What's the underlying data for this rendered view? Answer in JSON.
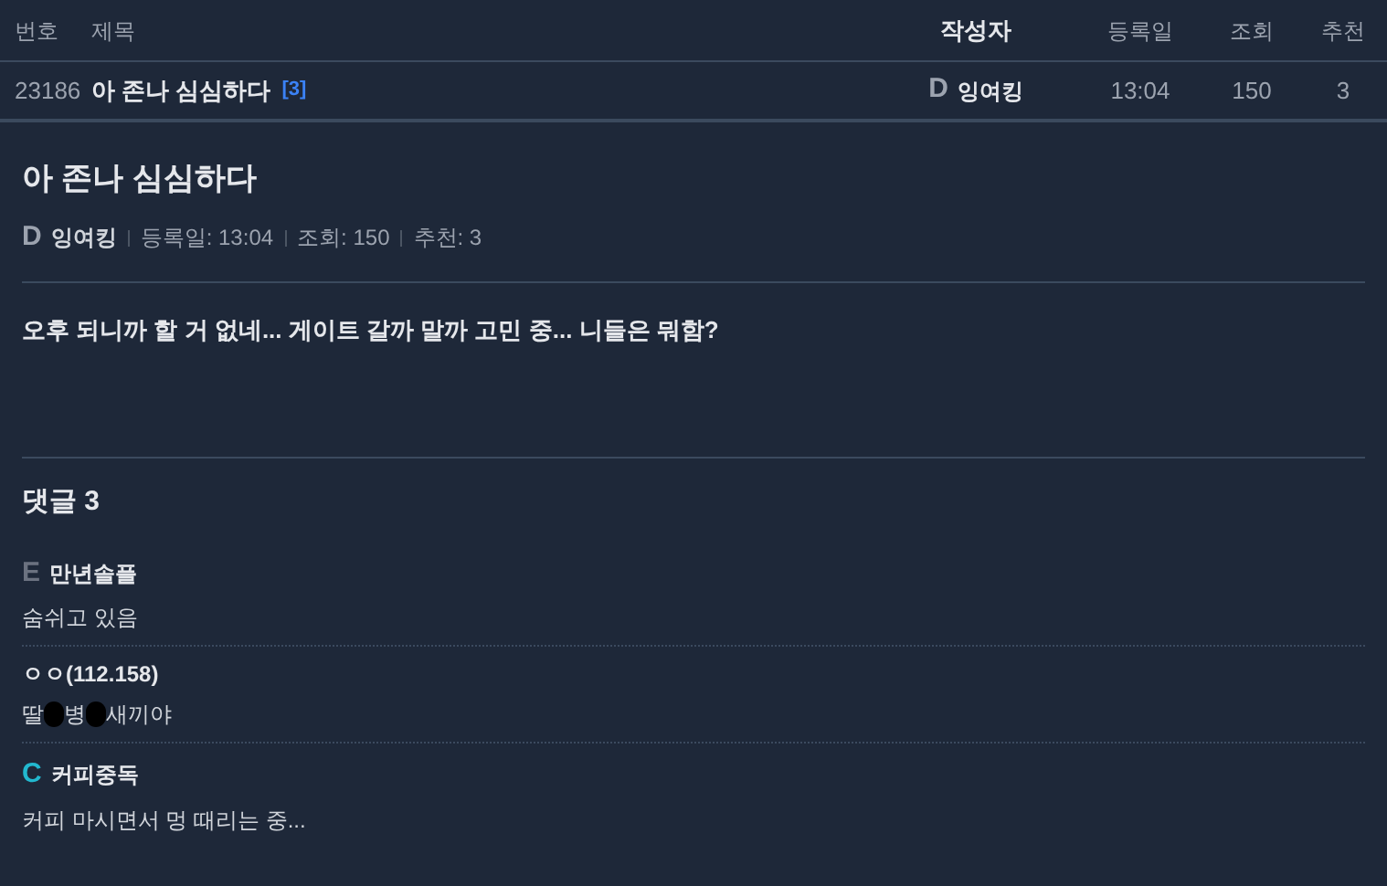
{
  "table": {
    "columns": [
      {
        "label": "번호",
        "bold": false
      },
      {
        "label": "제목",
        "bold": false
      },
      {
        "label": "작성자",
        "bold": true
      },
      {
        "label": "등록일",
        "bold": false
      },
      {
        "label": "조회",
        "bold": false
      },
      {
        "label": "추천",
        "bold": false
      }
    ],
    "rows": [
      {
        "number": "23186",
        "title": "아 존나 심심하다",
        "comment_count": "[3]",
        "grade": {
          "letter": "D",
          "color": "#9ca3af"
        },
        "author": "잉여킹",
        "date": "13:04",
        "views": "150",
        "likes": "3"
      }
    ]
  },
  "post": {
    "title": "아 존나 심심하다",
    "grade": {
      "letter": "D",
      "color": "#9ca3af"
    },
    "author": "잉여킹",
    "meta": [
      "등록일: 13:04",
      "조회: 150",
      "추천: 3"
    ],
    "body": "오후 되니까 할 거 없네... 게이트 갈까 말까 고민 중... 니들은 뭐함?"
  },
  "comments": {
    "heading": "댓글 3",
    "items": [
      {
        "grade": {
          "letter": "E",
          "color": "#6b7280"
        },
        "author": "만년솔플",
        "segments": [
          {
            "kind": "text",
            "text": "숨쉬고 있음"
          }
        ]
      },
      {
        "author": "ㅇㅇ(112.158)",
        "segments": [
          {
            "kind": "text",
            "text": "딸"
          },
          {
            "kind": "redacted"
          },
          {
            "kind": "text",
            "text": "병"
          },
          {
            "kind": "redacted"
          },
          {
            "kind": "text",
            "text": "새끼야"
          }
        ]
      },
      {
        "grade": {
          "letter": "C",
          "color": "#22b8cf"
        },
        "author": "커피중독",
        "segments": [
          {
            "kind": "text",
            "text": "커피 마시면서 멍 때리는 중..."
          }
        ]
      }
    ]
  }
}
